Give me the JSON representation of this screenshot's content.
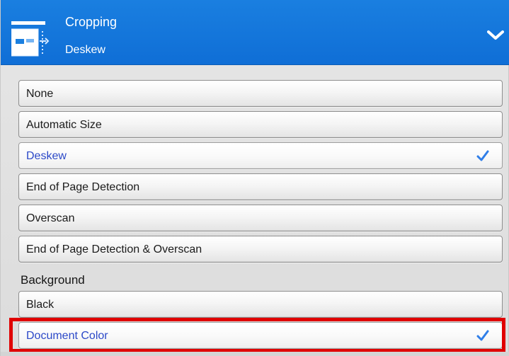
{
  "header": {
    "title": "Cropping",
    "subtitle": "Deskew",
    "icon": "crop-document-icon",
    "chevron_icon": "chevron-down-icon",
    "background_color": "#1677de"
  },
  "options": [
    {
      "label": "None",
      "selected": false
    },
    {
      "label": "Automatic Size",
      "selected": false
    },
    {
      "label": "Deskew",
      "selected": true
    },
    {
      "label": "End of Page Detection",
      "selected": false
    },
    {
      "label": "Overscan",
      "selected": false
    },
    {
      "label": "End of Page Detection & Overscan",
      "selected": false
    }
  ],
  "background_section": {
    "label": "Background",
    "options": [
      {
        "label": "Black",
        "selected": false
      },
      {
        "label": "Document Color",
        "selected": true
      }
    ]
  },
  "accent_colors": {
    "selected_text": "#2c49c8",
    "checkmark": "#2f7ee8",
    "highlight_border": "#e00000"
  }
}
